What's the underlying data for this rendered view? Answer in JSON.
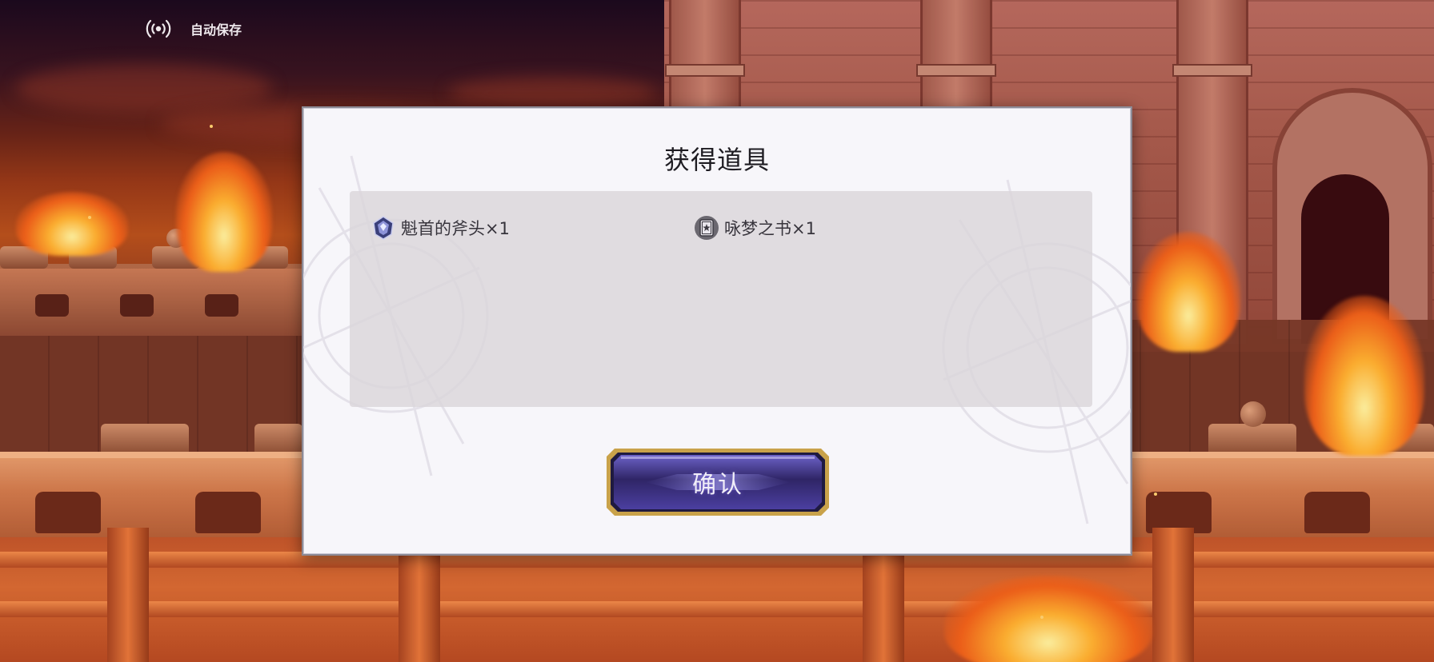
{
  "hud": {
    "autosave_label": "自动保存",
    "autosave_icon": "signal-broadcast-icon"
  },
  "dialog": {
    "title": "获得道具",
    "items": [
      {
        "name": "魁首的斧头×1",
        "icon": "axe-head-crystal-icon"
      },
      {
        "name": "咏梦之书×1",
        "icon": "dream-book-icon"
      }
    ],
    "confirm_label": "确认"
  },
  "colors": {
    "dialog_background": "#f7f6fa",
    "panel_background": "#dad6da",
    "button_fill": "#3a2e7a",
    "button_border": "#c9a24a",
    "title_text": "#1e1c22"
  }
}
